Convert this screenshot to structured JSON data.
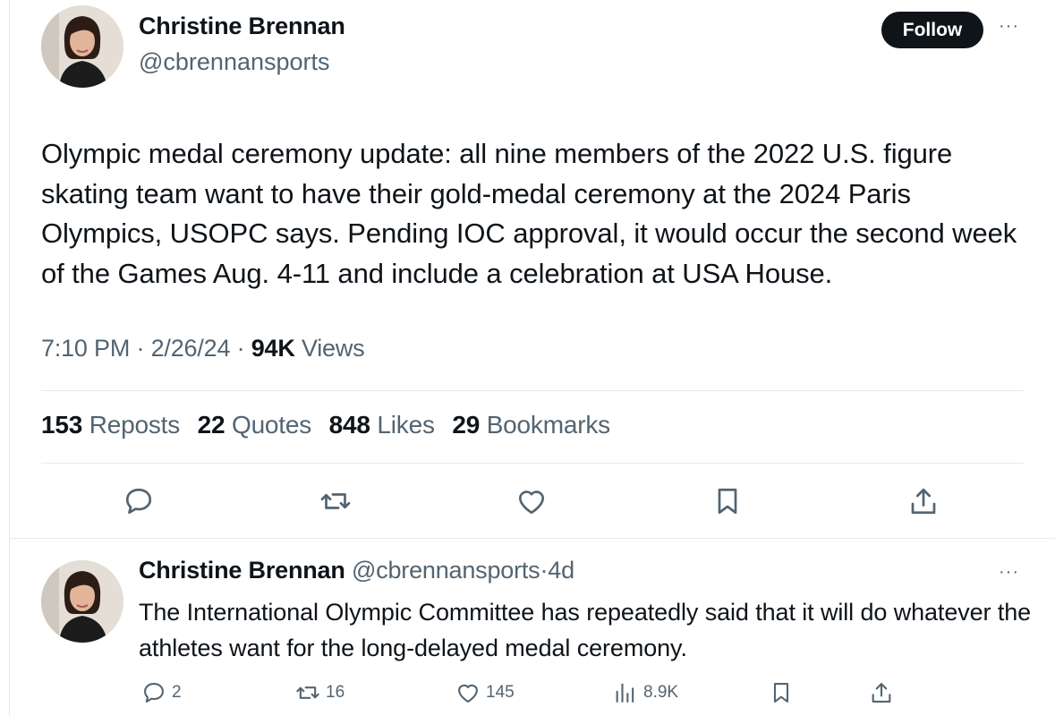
{
  "main_tweet": {
    "author_name": "Christine Brennan",
    "author_handle": "@cbrennansports",
    "follow_label": "Follow",
    "more_label": "···",
    "text": "Olympic medal ceremony update: all nine members of the 2022 U.S. figure skating team want to have their gold-medal ceremony at the 2024 Paris Olympics, USOPC says. Pending IOC approval, it would occur the second week of the Games Aug. 4-11 and include a celebration at USA House.",
    "time": "7:10 PM",
    "date": "2/26/24",
    "separator": "·",
    "views_count": "94K",
    "views_label": "Views",
    "stats": [
      {
        "count": "153",
        "label": "Reposts"
      },
      {
        "count": "22",
        "label": "Quotes"
      },
      {
        "count": "848",
        "label": "Likes"
      },
      {
        "count": "29",
        "label": "Bookmarks"
      }
    ],
    "actions": [
      "reply-icon",
      "repost-icon",
      "like-icon",
      "bookmark-icon",
      "share-icon"
    ]
  },
  "reply_tweet": {
    "author_name": "Christine Brennan",
    "author_handle": "@cbrennansports",
    "separator": "·",
    "age": "4d",
    "more_label": "···",
    "text": "The International Olympic Committee has repeatedly said that it will do whatever the athletes want for the long-delayed medal ceremony.",
    "replies": "2",
    "reposts": "16",
    "likes": "145",
    "views": "8.9K"
  },
  "colors": {
    "text": "#0f1419",
    "muted": "#536471",
    "divider": "#e6e9eb",
    "follow_bg": "#0f1419"
  }
}
